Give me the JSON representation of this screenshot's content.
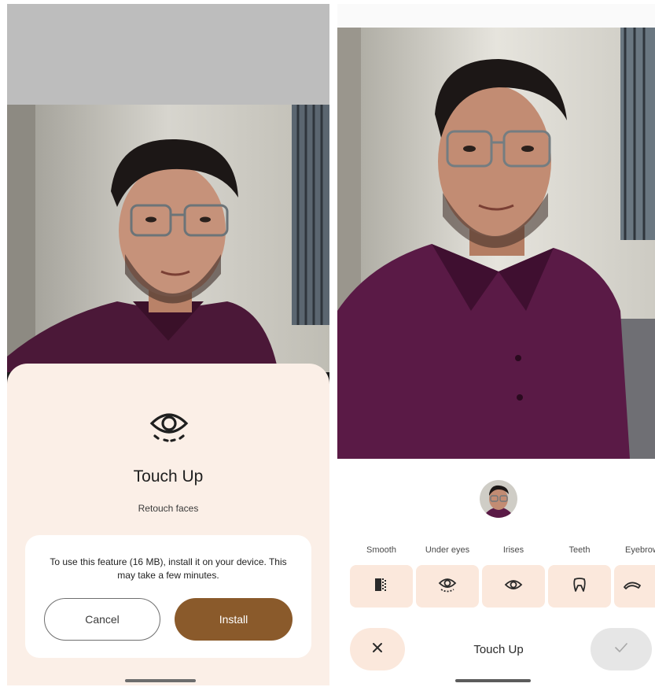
{
  "left_screen": {
    "sheet": {
      "icon": "eye-icon",
      "title": "Touch Up",
      "subtitle": "Retouch faces",
      "message": "To use this feature (16 MB), install it on your device. This may take a few minutes.",
      "cancel_label": "Cancel",
      "install_label": "Install",
      "accent_color": "#8a5a2b",
      "sheet_color": "#fbefe7"
    }
  },
  "right_screen": {
    "title": "Touch Up",
    "tools": [
      {
        "label": "Smooth",
        "icon": "smooth-icon"
      },
      {
        "label": "Under eyes",
        "icon": "under-eyes-icon"
      },
      {
        "label": "Irises",
        "icon": "iris-icon"
      },
      {
        "label": "Teeth",
        "icon": "tooth-icon"
      },
      {
        "label": "Eyebrow",
        "icon": "eyebrow-icon"
      }
    ],
    "close_icon": "close-icon",
    "confirm_icon": "check-icon",
    "tool_bg_color": "#fbe8dc"
  }
}
